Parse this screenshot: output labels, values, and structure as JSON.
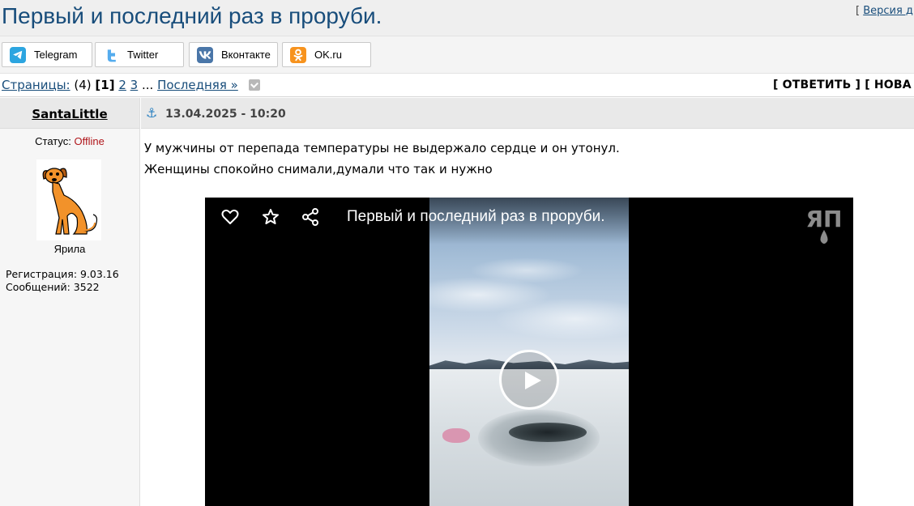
{
  "topic": {
    "title": "Первый и последний раз в проруби.",
    "version_prefix": "[ ",
    "version_link": "Версия д"
  },
  "share": {
    "buttons": [
      {
        "label": "Telegram",
        "icon": "telegram-icon"
      },
      {
        "label": "Twitter",
        "icon": "twitter-icon"
      },
      {
        "label": "Вконтакте",
        "icon": "vk-icon"
      },
      {
        "label": "OK.ru",
        "icon": "ok-icon"
      }
    ]
  },
  "pagination": {
    "label": "Страницы:",
    "count": "(4)",
    "current": "[1]",
    "pages": [
      "2",
      "3"
    ],
    "ellipsis": "...",
    "last": "Последняя »"
  },
  "actions": {
    "text": "[ ОТВЕТИТЬ ] [ НОВА"
  },
  "author": {
    "name": "SantaLittle",
    "status_label": "Статус:",
    "status_value": "Offline",
    "rank": "Ярила",
    "registration": "Регистрация: 9.03.16",
    "messages": "Сообщений: 3522"
  },
  "post": {
    "date": "13.04.2025 - 10:20",
    "lines": [
      "У мужчины от перепада температуры не выдержало сердце и он утонул.",
      "Женщины спокойно снимали,думали что так и нужно"
    ]
  },
  "video": {
    "title": "Первый и последний раз в проруби.",
    "logo_text": "ЯП"
  },
  "colors": {
    "title_blue": "#184d7b",
    "offline_red": "#b0161b",
    "anchor_blue": "#2f83c2"
  }
}
